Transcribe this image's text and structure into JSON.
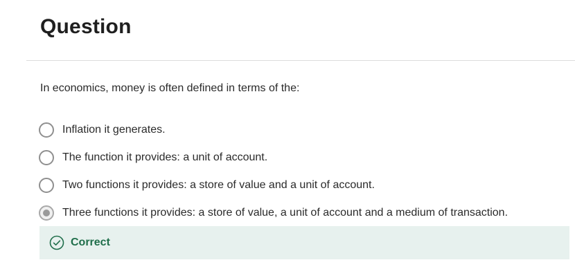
{
  "header": {
    "title": "Question"
  },
  "question": {
    "prompt": "In economics, money is often defined in terms of the:",
    "options": [
      {
        "label": "Inflation it generates.",
        "selected": false
      },
      {
        "label": "The function it provides: a unit of account.",
        "selected": false
      },
      {
        "label": "Two functions it provides: a store of value and a unit of account.",
        "selected": false
      },
      {
        "label": "Three functions it provides: a store of value, a unit of account and a medium of transaction.",
        "selected": true
      }
    ]
  },
  "feedback": {
    "icon": "check-circle-icon",
    "text": "Correct",
    "color": "#1f6e4a",
    "background": "#e7f1ee"
  }
}
